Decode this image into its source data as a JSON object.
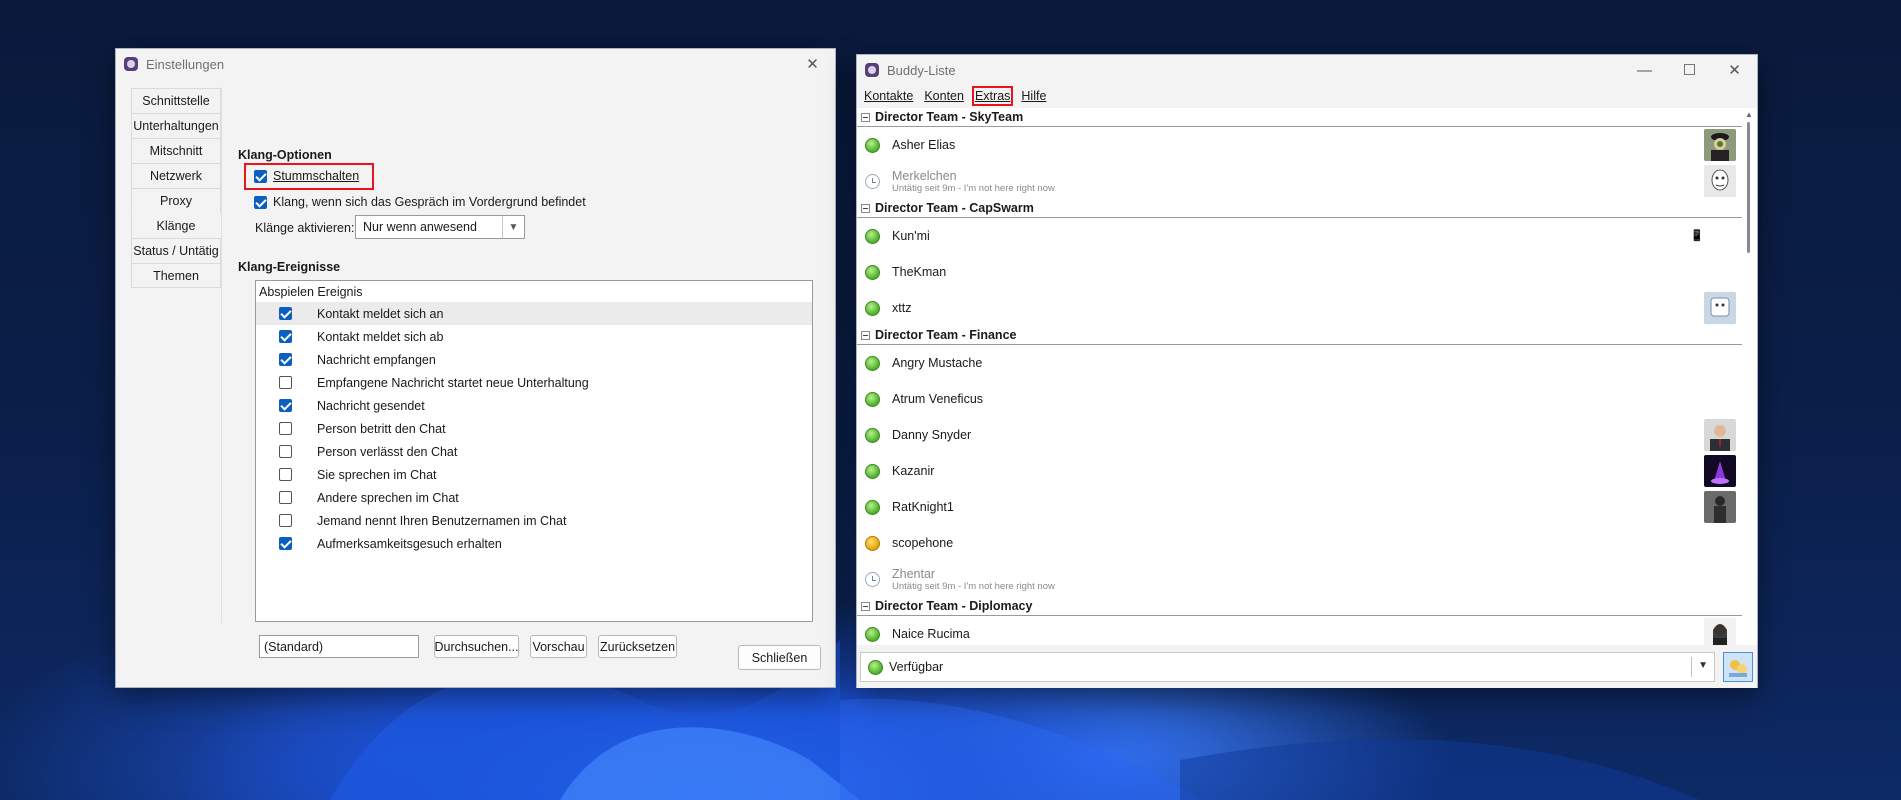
{
  "settings": {
    "title": "Einstellungen",
    "tabs": [
      "Schnittstelle",
      "Unterhaltungen",
      "Mitschnitt",
      "Netzwerk",
      "Proxy",
      "Klänge",
      "Status / Untätig",
      "Themen"
    ],
    "active_tab": "Klänge",
    "sound_options_title": "Klang-Optionen",
    "mute_label": "Stummschalten",
    "mute_checked": true,
    "foreground_label": "Klang, wenn sich das Gespräch im Vordergrund befindet",
    "foreground_checked": true,
    "enable_sounds_label": "Klänge aktivieren:",
    "enable_sounds_value": "Nur wenn anwesend",
    "events_title": "Klang-Ereignisse",
    "events_header": "Abspielen Ereignis",
    "events": [
      {
        "label": "Kontakt meldet sich an",
        "checked": true
      },
      {
        "label": "Kontakt meldet sich ab",
        "checked": true
      },
      {
        "label": "Nachricht empfangen",
        "checked": true
      },
      {
        "label": "Empfangene Nachricht startet neue Unterhaltung",
        "checked": false
      },
      {
        "label": "Nachricht gesendet",
        "checked": true
      },
      {
        "label": "Person betritt den Chat",
        "checked": false
      },
      {
        "label": "Person verlässt den Chat",
        "checked": false
      },
      {
        "label": "Sie sprechen im Chat",
        "checked": false
      },
      {
        "label": "Andere sprechen im Chat",
        "checked": false
      },
      {
        "label": "Jemand nennt Ihren Benutzernamen im Chat",
        "checked": false
      },
      {
        "label": "Aufmerksamkeitsgesuch erhalten",
        "checked": true
      }
    ],
    "file_value": "(Standard)",
    "browse_label": "Durchsuchen...",
    "preview_label": "Vorschau",
    "reset_label": "Zurücksetzen",
    "close_label": "Schließen"
  },
  "buddy": {
    "title": "Buddy-Liste",
    "menu": [
      "Kontakte",
      "Konten",
      "Extras",
      "Hilfe"
    ],
    "groups": [
      {
        "name": "Director Team - SkyTeam",
        "buddies": [
          {
            "name": "Asher Elias",
            "status": "online",
            "avatar": "man-hat"
          },
          {
            "name": "Merkelchen",
            "status": "idle",
            "sub": "Untätig seit 9m - I'm not here right now",
            "avatar": "sketch-face"
          }
        ]
      },
      {
        "name": "Director Team - CapSwarm",
        "buddies": [
          {
            "name": "Kun'mi",
            "status": "online",
            "avatar": "phone-icon"
          },
          {
            "name": "TheKman",
            "status": "online"
          },
          {
            "name": "xttz",
            "status": "online",
            "avatar": "mask"
          }
        ]
      },
      {
        "name": "Director Team - Finance",
        "buddies": [
          {
            "name": "Angry Mustache",
            "status": "online"
          },
          {
            "name": "Atrum Veneficus",
            "status": "online"
          },
          {
            "name": "Danny Snyder",
            "status": "online",
            "avatar": "suit-man"
          },
          {
            "name": "Kazanir",
            "status": "online",
            "avatar": "purple-flask"
          },
          {
            "name": "RatKnight1",
            "status": "online",
            "avatar": "dark-figure"
          },
          {
            "name": "scopehone",
            "status": "away"
          },
          {
            "name": "Zhentar",
            "status": "idle",
            "sub": "Untätig seit 9m - I'm not here right now"
          }
        ]
      },
      {
        "name": "Director Team - Diplomacy",
        "buddies": [
          {
            "name": "Naice Rucima",
            "status": "online",
            "avatar": "woman"
          }
        ]
      }
    ],
    "status_value": "Verfügbar"
  }
}
